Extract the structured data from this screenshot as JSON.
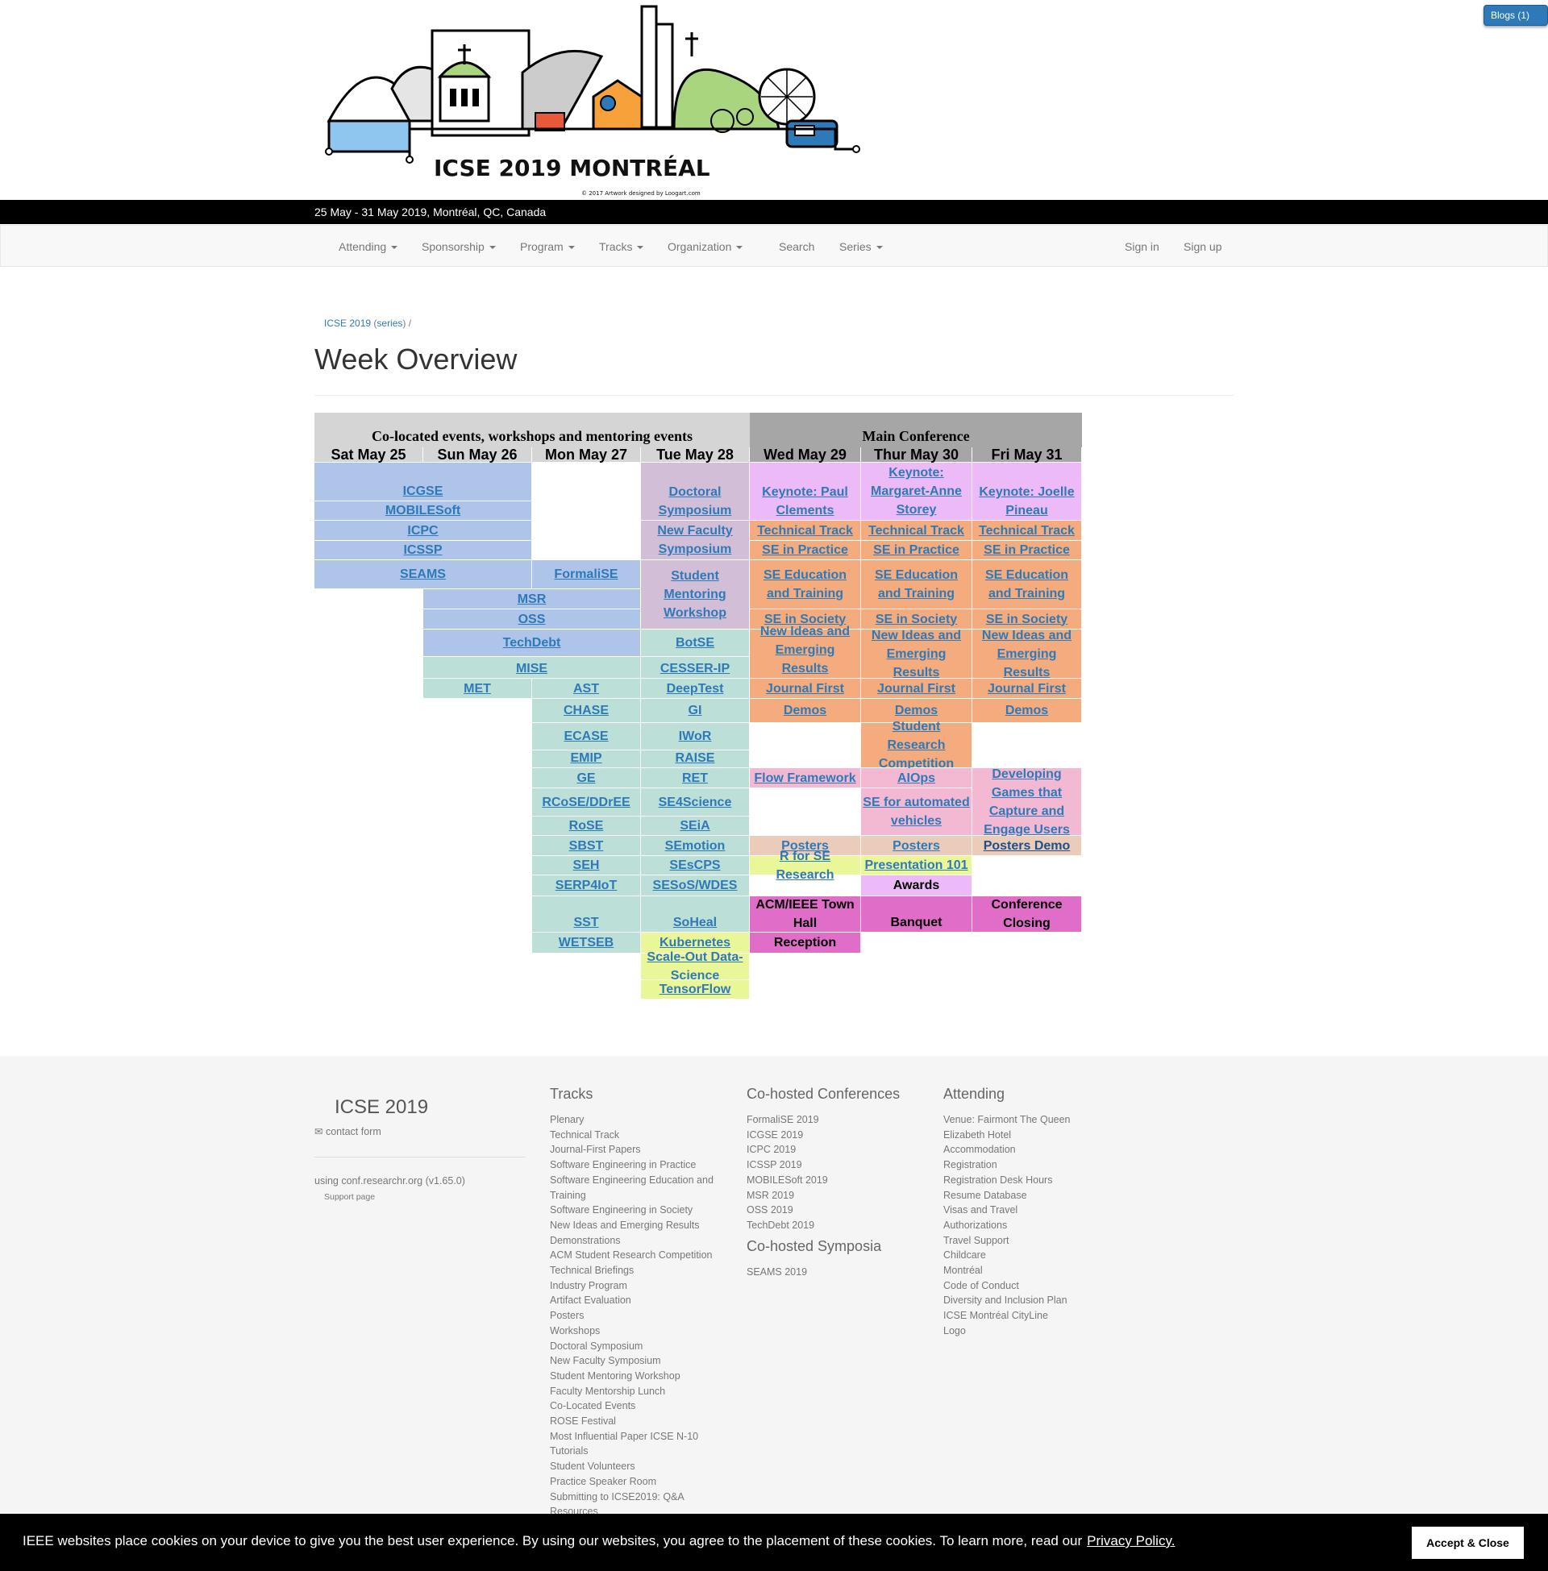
{
  "banner": {
    "logo_text": "ICSE 2019 MONTRÉAL",
    "logo_credit": "© 2017 Artwork designed by Loogart.com",
    "blogs_label": "Blogs (1) >>"
  },
  "dateline": "25 May - 31 May 2019, Montréal, QC, Canada",
  "nav": {
    "left": [
      "Attending",
      "Sponsorship",
      "Program",
      "Tracks",
      "Organization"
    ],
    "search": "Search",
    "series": "Series",
    "sign_in": "Sign in",
    "sign_up": "Sign up"
  },
  "breadcrumb": {
    "event": "ICSE 2019",
    "series": "series",
    "sep": "/"
  },
  "page_title": "Week Overview",
  "grid": {
    "colocated_header": "Co-located events, workshops and mentoring events",
    "main_header": "Main Conference",
    "days": [
      "Sat May 25",
      "Sun May 26",
      "Mon May 27",
      "Tue May 28",
      "Wed May 29",
      "Thur May 30",
      "Fri May 31"
    ],
    "colors": {
      "blue": "#aec4e8",
      "teal": "#bcdfd8",
      "mauve": "#d2bfd7",
      "orange": "#f4ac7e",
      "lavender": "#ebbaf7",
      "pink": "#f3b9d3",
      "peach": "#ebcbb9",
      "yellow": "#eaf798",
      "magenta": "#e06ec8"
    },
    "cells": [
      {
        "t": "ICGSE",
        "c": 0,
        "s": 2,
        "r": [
          0,
          1
        ],
        "col": "blue",
        "link": true,
        "align": "bottom"
      },
      {
        "t": "MOBILESoft",
        "c": 0,
        "s": 2,
        "r": [
          1,
          2
        ],
        "col": "blue",
        "link": true,
        "align": "bottom"
      },
      {
        "t": "ICPC",
        "c": 0,
        "s": 2,
        "r": [
          2,
          3
        ],
        "col": "blue",
        "link": true
      },
      {
        "t": "ICSSP",
        "c": 0,
        "s": 2,
        "r": [
          3,
          4
        ],
        "col": "blue",
        "link": true
      },
      {
        "t": "SEAMS",
        "c": 0,
        "s": 2,
        "r": [
          4,
          5
        ],
        "col": "blue",
        "link": true
      },
      {
        "t": "FormaliSE",
        "c": 2,
        "s": 1,
        "r": [
          4,
          5
        ],
        "col": "blue",
        "link": true
      },
      {
        "t": "MSR",
        "c": 1,
        "s": 2,
        "r": [
          5,
          6
        ],
        "col": "blue",
        "link": true
      },
      {
        "t": "OSS",
        "c": 1,
        "s": 2,
        "r": [
          6,
          7
        ],
        "col": "blue",
        "link": true
      },
      {
        "t": "TechDebt",
        "c": 1,
        "s": 2,
        "r": [
          7,
          8
        ],
        "col": "blue",
        "link": true
      },
      {
        "t": "MISE",
        "c": 1,
        "s": 2,
        "r": [
          8,
          9
        ],
        "col": "teal",
        "link": true,
        "align": "bottom"
      },
      {
        "t": "MET",
        "c": 1,
        "s": 1,
        "r": [
          9,
          10
        ],
        "col": "teal",
        "link": true
      },
      {
        "t": "AST",
        "c": 2,
        "s": 1,
        "r": [
          9,
          10
        ],
        "col": "teal",
        "link": true
      },
      {
        "t": "CHASE",
        "c": 2,
        "s": 1,
        "r": [
          10,
          11
        ],
        "col": "teal",
        "link": true
      },
      {
        "t": "ECASE",
        "c": 2,
        "s": 1,
        "r": [
          11,
          12
        ],
        "col": "teal",
        "link": true
      },
      {
        "t": "EMIP",
        "c": 2,
        "s": 1,
        "r": [
          12,
          13
        ],
        "col": "teal",
        "link": true,
        "align": "bottom"
      },
      {
        "t": "GE",
        "c": 2,
        "s": 1,
        "r": [
          13,
          14
        ],
        "col": "teal",
        "link": true
      },
      {
        "t": "RCoSE/DDrEE",
        "c": 2,
        "s": 1,
        "r": [
          14,
          15
        ],
        "col": "teal",
        "link": true
      },
      {
        "t": "RoSE",
        "c": 2,
        "s": 1,
        "r": [
          15,
          16
        ],
        "col": "teal",
        "link": true
      },
      {
        "t": "SBST",
        "c": 2,
        "s": 1,
        "r": [
          16,
          17
        ],
        "col": "teal",
        "link": true
      },
      {
        "t": "SEH",
        "c": 2,
        "s": 1,
        "r": [
          17,
          18
        ],
        "col": "teal",
        "link": true
      },
      {
        "t": "SERP4IoT",
        "c": 2,
        "s": 1,
        "r": [
          18,
          19
        ],
        "col": "teal",
        "link": true
      },
      {
        "t": "SST",
        "c": 2,
        "s": 1,
        "r": [
          19,
          20
        ],
        "col": "teal",
        "link": true,
        "align": "bottom"
      },
      {
        "t": "WETSEB",
        "c": 2,
        "s": 1,
        "r": [
          20,
          21
        ],
        "col": "teal",
        "link": true
      },
      {
        "t": "Doctoral Symposium",
        "c": 3,
        "s": 1,
        "r": [
          0,
          2
        ],
        "col": "mauve",
        "link": true,
        "align": "bottom"
      },
      {
        "t": "New Faculty Symposium",
        "c": 3,
        "s": 1,
        "r": [
          2,
          4
        ],
        "col": "mauve",
        "link": true
      },
      {
        "t": "Student Mentoring Workshop",
        "c": 3,
        "s": 1,
        "r": [
          4,
          7
        ],
        "col": "mauve",
        "link": true
      },
      {
        "t": "BotSE",
        "c": 3,
        "s": 1,
        "r": [
          7,
          8
        ],
        "col": "teal",
        "link": true
      },
      {
        "t": "CESSER-IP",
        "c": 3,
        "s": 1,
        "r": [
          8,
          9
        ],
        "col": "teal",
        "link": true,
        "align": "bottom"
      },
      {
        "t": "DeepTest",
        "c": 3,
        "s": 1,
        "r": [
          9,
          10
        ],
        "col": "teal",
        "link": true
      },
      {
        "t": "GI",
        "c": 3,
        "s": 1,
        "r": [
          10,
          11
        ],
        "col": "teal",
        "link": true
      },
      {
        "t": "IWoR",
        "c": 3,
        "s": 1,
        "r": [
          11,
          12
        ],
        "col": "teal",
        "link": true
      },
      {
        "t": "RAISE",
        "c": 3,
        "s": 1,
        "r": [
          12,
          13
        ],
        "col": "teal",
        "link": true,
        "align": "bottom"
      },
      {
        "t": "RET",
        "c": 3,
        "s": 1,
        "r": [
          13,
          14
        ],
        "col": "teal",
        "link": true
      },
      {
        "t": "SE4Science",
        "c": 3,
        "s": 1,
        "r": [
          14,
          15
        ],
        "col": "teal",
        "link": true
      },
      {
        "t": "SEiA",
        "c": 3,
        "s": 1,
        "r": [
          15,
          16
        ],
        "col": "teal",
        "link": true
      },
      {
        "t": "SEmotion",
        "c": 3,
        "s": 1,
        "r": [
          16,
          17
        ],
        "col": "teal",
        "link": true
      },
      {
        "t": "SEsCPS",
        "c": 3,
        "s": 1,
        "r": [
          17,
          18
        ],
        "col": "teal",
        "link": true
      },
      {
        "t": "SESoS/WDES",
        "c": 3,
        "s": 1,
        "r": [
          18,
          19
        ],
        "col": "teal",
        "link": true
      },
      {
        "t": "SoHeal",
        "c": 3,
        "s": 1,
        "r": [
          19,
          20
        ],
        "col": "teal",
        "link": true,
        "align": "bottom"
      },
      {
        "t": "Kubernetes",
        "c": 3,
        "s": 1,
        "r": [
          20,
          21
        ],
        "col": "yellow",
        "link": true
      },
      {
        "t": "Scale-Out Data-Science",
        "c": 3,
        "s": 1,
        "r": [
          21,
          22
        ],
        "col": "yellow",
        "link": true
      },
      {
        "t": "TensorFlow",
        "c": 3,
        "s": 1,
        "r": [
          22,
          23
        ],
        "col": "yellow",
        "link": true
      },
      {
        "t": "Keynote: Paul Clements",
        "c": 4,
        "s": 1,
        "r": [
          0,
          2
        ],
        "col": "lavender",
        "link": true,
        "align": "bottom"
      },
      {
        "t": "Keynote: Margaret-Anne Storey",
        "c": 5,
        "s": 1,
        "r": [
          0,
          2
        ],
        "col": "lavender",
        "link": true
      },
      {
        "t": "Keynote: Joelle Pineau",
        "c": 6,
        "s": 1,
        "r": [
          0,
          2
        ],
        "col": "lavender",
        "link": true,
        "align": "bottom"
      },
      {
        "t": "Technical Track",
        "c": 4,
        "s": 1,
        "r": [
          2,
          3
        ],
        "col": "orange",
        "link": true
      },
      {
        "t": "Technical Track",
        "c": 5,
        "s": 1,
        "r": [
          2,
          3
        ],
        "col": "orange",
        "link": true
      },
      {
        "t": "Technical Track",
        "c": 6,
        "s": 1,
        "r": [
          2,
          3
        ],
        "col": "orange",
        "link": true
      },
      {
        "t": "SE in Practice",
        "c": 4,
        "s": 1,
        "r": [
          3,
          4
        ],
        "col": "orange",
        "link": true
      },
      {
        "t": "SE in Practice",
        "c": 5,
        "s": 1,
        "r": [
          3,
          4
        ],
        "col": "orange",
        "link": true
      },
      {
        "t": "SE in Practice",
        "c": 6,
        "s": 1,
        "r": [
          3,
          4
        ],
        "col": "orange",
        "link": true
      },
      {
        "t": "SE Education and Training",
        "c": 4,
        "s": 1,
        "r": [
          4,
          6
        ],
        "col": "orange",
        "link": true
      },
      {
        "t": "SE Education and Training",
        "c": 5,
        "s": 1,
        "r": [
          4,
          6
        ],
        "col": "orange",
        "link": true
      },
      {
        "t": "SE Education and Training",
        "c": 6,
        "s": 1,
        "r": [
          4,
          6
        ],
        "col": "orange",
        "link": true
      },
      {
        "t": "SE in Society",
        "c": 4,
        "s": 1,
        "r": [
          6,
          7
        ],
        "col": "orange",
        "link": true
      },
      {
        "t": "SE in Society",
        "c": 5,
        "s": 1,
        "r": [
          6,
          7
        ],
        "col": "orange",
        "link": true
      },
      {
        "t": "SE in Society",
        "c": 6,
        "s": 1,
        "r": [
          6,
          7
        ],
        "col": "orange",
        "link": true
      },
      {
        "t": "New Ideas and Emerging Results",
        "c": 4,
        "s": 1,
        "r": [
          7,
          9
        ],
        "col": "orange",
        "link": true,
        "align": "bottom"
      },
      {
        "t": "New Ideas and Emerging Results",
        "c": 5,
        "s": 1,
        "r": [
          7,
          9
        ],
        "col": "orange",
        "link": true
      },
      {
        "t": "New Ideas and Emerging Results",
        "c": 6,
        "s": 1,
        "r": [
          7,
          9
        ],
        "col": "orange",
        "link": true
      },
      {
        "t": "Journal First",
        "c": 4,
        "s": 1,
        "r": [
          9,
          10
        ],
        "col": "orange",
        "link": true
      },
      {
        "t": "Journal First",
        "c": 5,
        "s": 1,
        "r": [
          9,
          10
        ],
        "col": "orange",
        "link": true
      },
      {
        "t": "Journal First",
        "c": 6,
        "s": 1,
        "r": [
          9,
          10
        ],
        "col": "orange",
        "link": true
      },
      {
        "t": "Demos",
        "c": 4,
        "s": 1,
        "r": [
          10,
          11
        ],
        "col": "orange",
        "link": true
      },
      {
        "t": "Demos",
        "c": 5,
        "s": 1,
        "r": [
          10,
          11
        ],
        "col": "orange",
        "link": true
      },
      {
        "t": "Demos",
        "c": 6,
        "s": 1,
        "r": [
          10,
          11
        ],
        "col": "orange",
        "link": true
      },
      {
        "t": "Student Research Competition",
        "c": 5,
        "s": 1,
        "r": [
          11,
          13
        ],
        "col": "orange",
        "link": true
      },
      {
        "t": "Flow Framework",
        "c": 4,
        "s": 1,
        "r": [
          13,
          14
        ],
        "col": "pink",
        "link": true
      },
      {
        "t": "AIOps",
        "c": 5,
        "s": 1,
        "r": [
          13,
          14
        ],
        "col": "pink",
        "link": true
      },
      {
        "t": "SE for automated vehicles",
        "c": 5,
        "s": 1,
        "r": [
          14,
          16
        ],
        "col": "pink",
        "link": true
      },
      {
        "t": "Developing Games that Capture and Engage Users",
        "c": 6,
        "s": 1,
        "r": [
          13,
          16
        ],
        "col": "pink",
        "link": true
      },
      {
        "t": "Posters",
        "c": 4,
        "s": 1,
        "r": [
          16,
          17
        ],
        "col": "peach",
        "link": true
      },
      {
        "t": "Posters",
        "c": 5,
        "s": 1,
        "r": [
          16,
          17
        ],
        "col": "peach",
        "link": true
      },
      {
        "t": "Posters Demo",
        "c": 6,
        "s": 1,
        "r": [
          16,
          17
        ],
        "col": "peach",
        "link": true,
        "dark": true
      },
      {
        "t": "R for SE Research",
        "c": 4,
        "s": 1,
        "r": [
          17,
          18
        ],
        "col": "yellow",
        "link": true
      },
      {
        "t": "Presentation 101",
        "c": 5,
        "s": 1,
        "r": [
          17,
          18
        ],
        "col": "yellow",
        "link": true
      },
      {
        "t": "Awards",
        "c": 5,
        "s": 1,
        "r": [
          18,
          19
        ],
        "col": "lavender",
        "link": false
      },
      {
        "t": "ACM/IEEE Town Hall",
        "c": 4,
        "s": 1,
        "r": [
          19,
          20
        ],
        "col": "magenta",
        "link": false
      },
      {
        "t": "Banquet",
        "c": 5,
        "s": 1,
        "r": [
          19,
          20
        ],
        "col": "magenta",
        "link": false,
        "align": "bottom"
      },
      {
        "t": "Conference Closing",
        "c": 6,
        "s": 1,
        "r": [
          19,
          20
        ],
        "col": "magenta",
        "link": false
      },
      {
        "t": "Reception",
        "c": 4,
        "s": 1,
        "r": [
          20,
          21
        ],
        "col": "magenta",
        "link": false
      }
    ]
  },
  "footer": {
    "brand": "ICSE 2019",
    "contact": "contact form",
    "using": "using conf.researchr.org (v1.65.0)",
    "support": "Support page",
    "tracks_title": "Tracks",
    "tracks": [
      "Plenary",
      "Technical Track",
      "Journal-First Papers",
      "Software Engineering in Practice",
      "Software Engineering Education and",
      "Training",
      "Software Engineering in Society",
      "New Ideas and Emerging Results",
      "Demonstrations",
      "ACM Student Research Competition",
      "Technical Briefings",
      "Industry Program",
      "Artifact Evaluation",
      "Posters",
      "Workshops",
      "Doctoral Symposium",
      "New Faculty Symposium",
      "Student Mentoring Workshop",
      "Faculty Mentorship Lunch",
      "Co-Located Events",
      "ROSE Festival",
      "Most Influential Paper ICSE N-10",
      "Tutorials",
      "Student Volunteers",
      "Practice Speaker Room",
      "Submitting to ICSE2019: Q&A",
      "Resources"
    ],
    "cohosted_title": "Co-hosted Conferences",
    "cohosted": [
      "FormaliSE 2019",
      "ICGSE 2019",
      "ICPC 2019",
      "ICSSP 2019",
      "MOBILESoft 2019",
      "MSR 2019",
      "OSS 2019",
      "TechDebt 2019"
    ],
    "symposia_title": "Co-hosted Symposia",
    "symposia": [
      "SEAMS 2019"
    ],
    "attending_title": "Attending",
    "attending": [
      "Venue: Fairmont The Queen",
      "Elizabeth Hotel",
      "Accommodation",
      "Registration",
      "Registration Desk Hours",
      "Resume Database",
      "Visas and Travel",
      "Authorizations",
      "Travel Support",
      "Childcare",
      "Montréal",
      "Code of Conduct",
      "Diversity and Inclusion Plan",
      "ICSE Montréal CityLine",
      "Logo"
    ]
  },
  "cookie": {
    "text": "IEEE websites place cookies on your device to give you the best user experience. By using our websites, you agree to the placement of these cookies. To learn more, read our",
    "link": "Privacy Policy.",
    "button": "Accept & Close"
  }
}
